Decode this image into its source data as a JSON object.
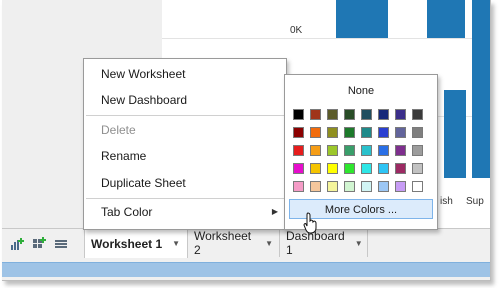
{
  "chart": {
    "tick_label": "0K",
    "x_labels": [
      "ish",
      "Sup"
    ],
    "colors": {
      "bar": "#1f77b4"
    }
  },
  "toolbar": {
    "icons": [
      "new-worksheet-icon",
      "new-dashboard-icon",
      "new-story-icon"
    ]
  },
  "tabs": [
    {
      "label": "Worksheet 1",
      "active": true
    },
    {
      "label": "Worksheet 2",
      "active": false
    },
    {
      "label": "Dashboard 1",
      "active": false
    }
  ],
  "context_menu": {
    "new_worksheet": "New Worksheet",
    "new_dashboard": "New Dashboard",
    "delete": "Delete",
    "rename": "Rename",
    "duplicate_sheet": "Duplicate Sheet",
    "tab_color": "Tab Color"
  },
  "color_palette": {
    "none_label": "None",
    "more_colors_label": "More Colors ...",
    "swatches": [
      [
        "#000000",
        "#a0341a",
        "#5c5c2a",
        "#294d27",
        "#1f4e5f",
        "#16297a",
        "#3b2e8a",
        "#3a3a3a"
      ],
      [
        "#8b0000",
        "#f26c0d",
        "#8f8f1f",
        "#1d7a2b",
        "#1f8a8a",
        "#2a3fd1",
        "#62649b",
        "#7f7f7f"
      ],
      [
        "#e61c1c",
        "#f59d16",
        "#9cc72b",
        "#399e6a",
        "#2ac1cc",
        "#2a6fe6",
        "#7e2f8e",
        "#9c9c9c"
      ],
      [
        "#e60dcc",
        "#f5c400",
        "#ffff00",
        "#2ee62e",
        "#2ee6e6",
        "#2ec4f5",
        "#9c2a63",
        "#c2c2c2"
      ],
      [
        "#f59cc7",
        "#f5c79c",
        "#f5f59c",
        "#d1f5d1",
        "#d1f5f5",
        "#9cc7f5",
        "#c79cf5",
        "#ffffff"
      ]
    ]
  }
}
